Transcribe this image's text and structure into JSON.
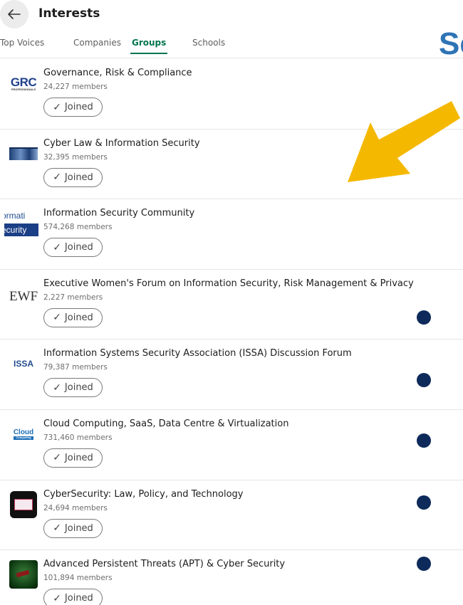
{
  "header": {
    "title": "Interests",
    "back_icon": "arrow-left-icon"
  },
  "overlay_text": "Se",
  "tabs": [
    {
      "label": "Top Voices",
      "active": false
    },
    {
      "label": "Companies",
      "active": false
    },
    {
      "label": "Groups",
      "active": true
    },
    {
      "label": "Schools",
      "active": false
    }
  ],
  "join_label": "Joined",
  "colors": {
    "accent": "#01754f",
    "arrow": "#f5b800",
    "dot": "#0d2a5a",
    "overlay_text": "#2e74b5"
  },
  "groups": [
    {
      "name": "Governance, Risk & Compliance",
      "members": "24,227 members",
      "logo_text": "GRC",
      "logo_subtext": "PROFESSIONALS"
    },
    {
      "name": "Cyber Law & Information Security",
      "members": "32,395 members"
    },
    {
      "name": "Information Security Community",
      "members": "574,268 members",
      "logo_text_1": "ormati",
      "logo_text_2": "ecurity"
    },
    {
      "name": "Executive Women's Forum on Information Security, Risk Management & Privacy",
      "members": "2,227 members",
      "logo_text": "EWF"
    },
    {
      "name": "Information Systems Security Association (ISSA) Discussion Forum",
      "members": "79,387 members",
      "logo_text": "ISSA"
    },
    {
      "name": "Cloud Computing, SaaS, Data Centre & Virtualization",
      "members": "731,460 members",
      "logo_text": "Cloud",
      "logo_subtext": "Computing"
    },
    {
      "name": "CyberSecurity: Law, Policy, and Technology",
      "members": "24,694 members"
    },
    {
      "name": "Advanced Persistent Threats (APT) & Cyber Security",
      "members": "101,894 members"
    }
  ]
}
